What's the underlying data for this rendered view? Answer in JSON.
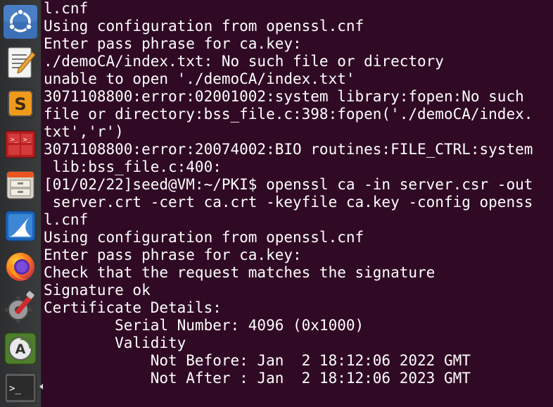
{
  "launcher": {
    "items": [
      {
        "name": "ubuntu-dash-icon"
      },
      {
        "name": "text-editor-icon"
      },
      {
        "name": "sublime-text-icon"
      },
      {
        "name": "terminator-icon"
      },
      {
        "name": "file-manager-icon"
      },
      {
        "name": "wireshark-icon"
      },
      {
        "name": "firefox-icon"
      },
      {
        "name": "system-settings-icon"
      },
      {
        "name": "software-updater-icon"
      },
      {
        "name": "terminal-icon"
      }
    ]
  },
  "terminal": {
    "lines": [
      "l.cnf",
      "Using configuration from openssl.cnf",
      "Enter pass phrase for ca.key:",
      "./demoCA/index.txt: No such file or directory",
      "unable to open './demoCA/index.txt'",
      "3071108800:error:02001002:system library:fopen:No such",
      "file or directory:bss_file.c:398:fopen('./demoCA/index.",
      "txt','r')",
      "3071108800:error:20074002:BIO routines:FILE_CTRL:system",
      " lib:bss_file.c:400:",
      "[01/02/22]seed@VM:~/PKI$ openssl ca -in server.csr -out",
      " server.crt -cert ca.crt -keyfile ca.key -config openss",
      "l.cnf",
      "Using configuration from openssl.cnf",
      "Enter pass phrase for ca.key:",
      "Check that the request matches the signature",
      "Signature ok",
      "Certificate Details:",
      "        Serial Number: 4096 (0x1000)",
      "        Validity",
      "            Not Before: Jan  2 18:12:06 2022 GMT",
      "            Not After : Jan  2 18:12:06 2023 GMT"
    ]
  }
}
